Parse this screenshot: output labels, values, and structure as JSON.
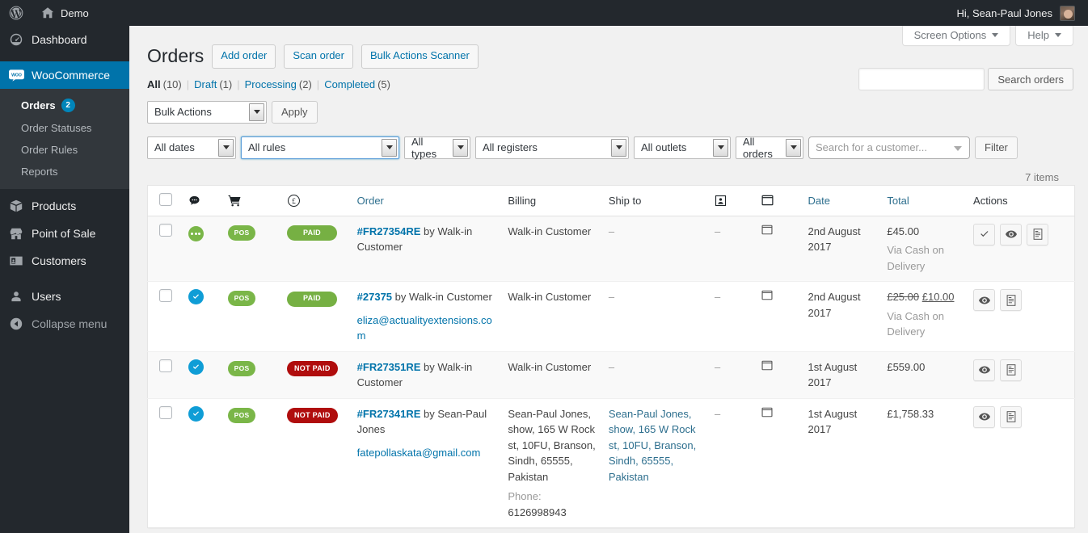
{
  "adminbar": {
    "wp_logo": "wordpress-logo-icon",
    "site_name": "Demo",
    "howdy": "Hi, Sean-Paul Jones"
  },
  "sidebar": {
    "items": [
      {
        "label": "Dashboard",
        "icon": "dashboard-icon",
        "current": false
      },
      {
        "label": "WooCommerce",
        "icon": "woocommerce-icon",
        "current": true
      },
      {
        "label": "Products",
        "icon": "products-icon",
        "current": false
      },
      {
        "label": "Point of Sale",
        "icon": "store-icon",
        "current": false
      },
      {
        "label": "Customers",
        "icon": "customers-icon",
        "current": false
      },
      {
        "label": "Users",
        "icon": "users-icon",
        "current": false
      }
    ],
    "submenu": [
      {
        "label": "Orders",
        "current": true,
        "count": "2"
      },
      {
        "label": "Order Statuses",
        "current": false
      },
      {
        "label": "Order Rules",
        "current": false
      },
      {
        "label": "Reports",
        "current": false
      }
    ],
    "collapse_label": "Collapse menu"
  },
  "screen_meta": {
    "screen_options": "Screen Options",
    "help": "Help"
  },
  "header": {
    "title": "Orders",
    "actions": [
      "Add order",
      "Scan order",
      "Bulk Actions Scanner"
    ]
  },
  "status_links": [
    {
      "label": "All",
      "count": "(10)",
      "current": true
    },
    {
      "label": "Draft",
      "count": "(1)",
      "current": false
    },
    {
      "label": "Processing",
      "count": "(2)",
      "current": false
    },
    {
      "label": "Completed",
      "count": "(5)",
      "current": false
    }
  ],
  "search": {
    "value": "",
    "placeholder": "",
    "button": "Search orders"
  },
  "tablenav": {
    "bulk_actions": "Bulk Actions",
    "apply": "Apply",
    "all_dates": "All dates",
    "all_rules": "All rules",
    "all_types": "All types",
    "all_registers": "All registers",
    "all_outlets": "All outlets",
    "all_orders": "All orders",
    "customer_placeholder": "Search for a customer...",
    "filter": "Filter",
    "displaying_num": "7 items"
  },
  "table": {
    "columns": [
      {
        "key": "cb",
        "label": "",
        "icon": "select-all-checkbox"
      },
      {
        "key": "note",
        "label": "",
        "icon": "comment-bubble-icon"
      },
      {
        "key": "pos",
        "label": "",
        "icon": "shopping-cart-icon"
      },
      {
        "key": "paid",
        "label": "",
        "icon": "pound-currency-icon"
      },
      {
        "key": "order",
        "label": "Order",
        "sortable": true
      },
      {
        "key": "billing",
        "label": "Billing",
        "sortable": false
      },
      {
        "key": "shipto",
        "label": "Ship to",
        "sortable": false
      },
      {
        "key": "customer",
        "label": "",
        "icon": "customer-card-icon"
      },
      {
        "key": "window",
        "label": "",
        "icon": "window-icon"
      },
      {
        "key": "date",
        "label": "Date",
        "sortable": true
      },
      {
        "key": "total",
        "label": "Total",
        "sortable": true
      },
      {
        "key": "actions",
        "label": "Actions",
        "sortable": false
      }
    ],
    "rows": [
      {
        "status": "processing",
        "pos": "POS",
        "paid": "PAID",
        "paid_state": "paid",
        "order_id": "#FR27354RE",
        "order_by": " by Walk-in Customer",
        "email": "",
        "billing": "Walk-in Customer",
        "shipto": "–",
        "shipto_link": false,
        "customer": "–",
        "date": "2nd August 2017",
        "total": "£45.00",
        "total_old": "",
        "via": "Via Cash on Delivery",
        "phone": "",
        "actions": [
          "check-icon",
          "eye-icon",
          "receipt-icon"
        ]
      },
      {
        "status": "completed",
        "pos": "POS",
        "paid": "PAID",
        "paid_state": "paid",
        "order_id": "#27375",
        "order_by": " by Walk-in Customer",
        "email": "eliza@actualityextensions.com",
        "billing": "Walk-in Customer",
        "shipto": "–",
        "shipto_link": false,
        "customer": "–",
        "date": "2nd August 2017",
        "total": "£10.00",
        "total_old": "£25.00",
        "via": "Via Cash on Delivery",
        "phone": "",
        "actions": [
          "eye-icon",
          "receipt-icon"
        ]
      },
      {
        "status": "completed",
        "pos": "POS",
        "paid": "NOT PAID",
        "paid_state": "notpaid",
        "order_id": "#FR27351RE",
        "order_by": " by Walk-in Customer",
        "email": "",
        "billing": "Walk-in Customer",
        "shipto": "–",
        "shipto_link": false,
        "customer": "–",
        "date": "1st August 2017",
        "total": "£559.00",
        "total_old": "",
        "via": "",
        "phone": "",
        "actions": [
          "eye-icon",
          "receipt-icon"
        ]
      },
      {
        "status": "completed",
        "pos": "POS",
        "paid": "NOT PAID",
        "paid_state": "notpaid",
        "order_id": "#FR27341RE",
        "order_by": " by Sean-Paul Jones",
        "email": "fatepollaskata@gmail.com",
        "billing": "Sean-Paul Jones, show, 165 W Rock st, 10FU, Branson, Sindh, 65555, Pakistan",
        "shipto": "Sean-Paul Jones, show, 165 W Rock st, 10FU, Branson, Sindh, 65555, Pakistan",
        "shipto_link": true,
        "customer": "–",
        "date": "1st August 2017",
        "total": "£1,758.33",
        "total_old": "",
        "via": "",
        "phone_label": "Phone:",
        "phone": "6126998943",
        "actions": [
          "eye-icon",
          "receipt-icon"
        ]
      }
    ]
  },
  "colors": {
    "admin_bar": "#23282d",
    "accent_blue": "#0073aa",
    "link_blue": "#0073aa",
    "green_paid": "#76b043",
    "green_pos": "#7ab648",
    "red_notpaid": "#b00d0d",
    "status_completed": "#0f9dd6"
  }
}
